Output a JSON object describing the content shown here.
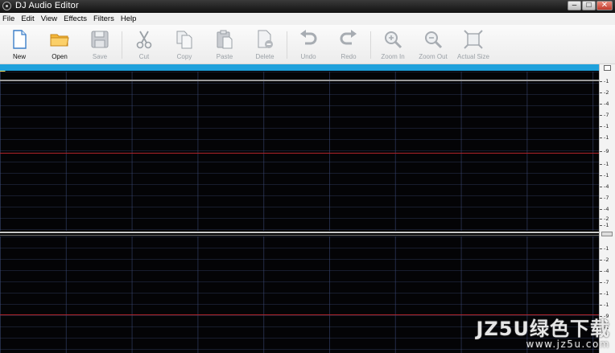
{
  "window": {
    "title": "DJ Audio Editor",
    "controls": [
      "–",
      "□",
      "✕"
    ]
  },
  "menu": [
    "File",
    "Edit",
    "View",
    "Effects",
    "Filters",
    "Help"
  ],
  "toolbar": {
    "new": {
      "label": "New",
      "icon": "new-file-icon",
      "enabled": true
    },
    "open": {
      "label": "Open",
      "icon": "open-folder-icon",
      "enabled": true
    },
    "save": {
      "label": "Save",
      "icon": "save-icon",
      "enabled": false
    },
    "cut": {
      "label": "Cut",
      "icon": "scissors-icon",
      "enabled": false
    },
    "copy": {
      "label": "Copy",
      "icon": "copy-icon",
      "enabled": false
    },
    "paste": {
      "label": "Paste",
      "icon": "paste-icon",
      "enabled": false
    },
    "delete": {
      "label": "Delete",
      "icon": "delete-icon",
      "enabled": false
    },
    "undo": {
      "label": "Undo",
      "icon": "undo-icon",
      "enabled": false
    },
    "redo": {
      "label": "Redo",
      "icon": "redo-icon",
      "enabled": false
    },
    "zoom_in": {
      "label": "Zoom In",
      "icon": "zoom-in-icon",
      "enabled": false
    },
    "zoom_out": {
      "label": "Zoom Out",
      "icon": "zoom-out-icon",
      "enabled": false
    },
    "actual_size": {
      "label": "Actual Size",
      "icon": "actual-size-icon",
      "enabled": false
    }
  },
  "ruler": {
    "track1": [
      "-1",
      "-2",
      "-4",
      "-7",
      "-1",
      "-1",
      "-9",
      "-1",
      "-1",
      "-4",
      "-7",
      "-4",
      "-2",
      "-1"
    ],
    "track2": [
      "-1",
      "-2",
      "-4",
      "-7",
      "-1",
      "-1",
      "-9",
      "-1"
    ]
  },
  "colors": {
    "timeline": "#1fa1dc",
    "waveform_bg": "#040406",
    "center_line": "#b0242a"
  },
  "watermark": {
    "main": "JZ5U绿色下载",
    "url": "www.jz5u.com"
  }
}
